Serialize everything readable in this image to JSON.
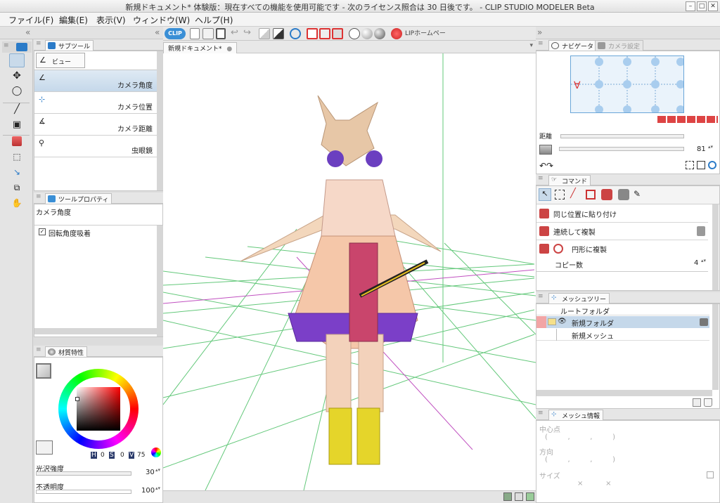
{
  "window": {
    "title": "新規ドキュメント* 体験版：現在すべての機能を使用可能です - 次のライセンス照合は 30 日後です。 - CLIP STUDIO MODELER Beta"
  },
  "menu": [
    "ファイル(F)",
    "編集(E)",
    "表示(V)",
    "ウィンドウ(W)",
    "ヘルプ(H)"
  ],
  "toolbar": {
    "clip_label": "CLIP",
    "lip_home": "LIPホームページ"
  },
  "subtool": {
    "tab": "サブツール",
    "group": "ビュー",
    "items": [
      "カメラ角度",
      "カメラ位置",
      "カメラ距離",
      "虫眼鏡"
    ]
  },
  "toolprop": {
    "tab": "ツールプロパティ",
    "name": "カメラ角度",
    "checkbox_label": "回転角度吸着"
  },
  "material": {
    "tab": "材質特性",
    "hsv": {
      "h": "0",
      "s": "0",
      "v": "75"
    },
    "gloss_label": "光沢強度",
    "gloss_value": "30",
    "opacity_label": "不透明度",
    "opacity_value": "100"
  },
  "document": {
    "tab": "新規ドキュメント*"
  },
  "navigator": {
    "tab": "ナビゲータ",
    "tab2": "カメラ設定",
    "distance_label": "距離",
    "zoom_value": "81"
  },
  "command": {
    "tab": "コマンド",
    "items": [
      "同じ位置に貼り付け",
      "連続して複製",
      "円形に複製"
    ],
    "copy_label": "コピー数",
    "copy_value": "4"
  },
  "mesh_tree": {
    "tab": "メッシュツリー",
    "root": "ルートフォルダ",
    "folder": "新規フォルダ",
    "mesh": "新規メッシュ"
  },
  "mesh_info": {
    "tab": "メッシュ情報",
    "center_label": "中心点",
    "center_value": "(         ,         ,         )",
    "direction_label": "方向",
    "direction_value": "(         ,         ,         )",
    "size_label": "サイズ",
    "size_value": "×          ×"
  },
  "colors": {
    "accent_blue": "#3a8fd6",
    "selection": "#c5d8ea"
  }
}
